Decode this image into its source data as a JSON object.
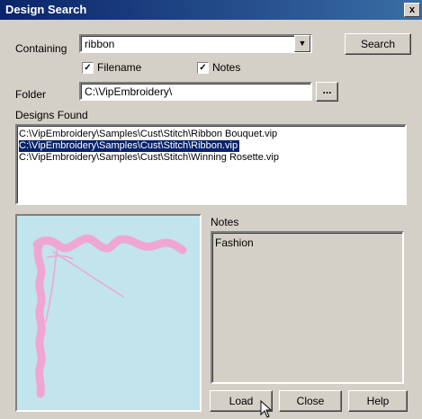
{
  "window": {
    "title": "Design Search",
    "close_glyph": "x"
  },
  "search": {
    "containing_label": "Containing",
    "containing_value": "ribbon",
    "search_button": "Search",
    "filename_label": "Filename",
    "filename_checked": true,
    "notes_label": "Notes",
    "notes_checked": true
  },
  "folder": {
    "label": "Folder",
    "value": "C:\\VipEmbroidery\\",
    "browse_button": "..."
  },
  "results": {
    "label": "Designs Found",
    "items": [
      "C:\\VipEmbroidery\\Samples\\Cust\\Stitch\\Ribbon Bouquet.vip",
      "C:\\VipEmbroidery\\Samples\\Cust\\Stitch\\Ribbon.vip",
      "C:\\VipEmbroidery\\Samples\\Cust\\Stitch\\Winning Rosette.vip"
    ],
    "selected_index": 1
  },
  "preview": {
    "accent_color": "#f0a6d2",
    "background_color": "#c2e4ec"
  },
  "notes": {
    "label": "Notes",
    "text": "Fashion"
  },
  "buttons": {
    "load": "Load",
    "close": "Close",
    "help": "Help"
  }
}
